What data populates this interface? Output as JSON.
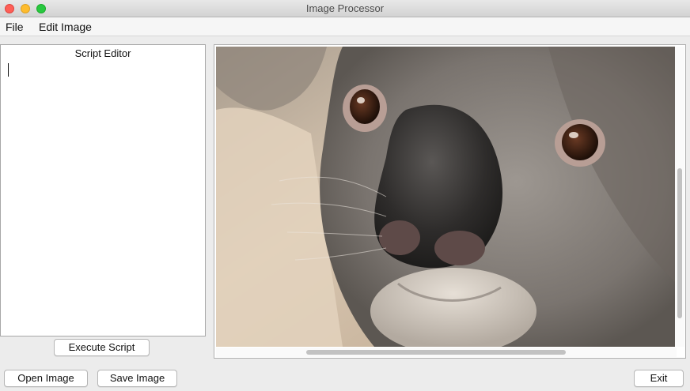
{
  "window": {
    "title": "Image Processor"
  },
  "menu": {
    "file": "File",
    "edit_image": "Edit Image"
  },
  "script_editor": {
    "title": "Script Editor",
    "content": ""
  },
  "buttons": {
    "execute_script": "Execute Script",
    "open_image": "Open Image",
    "save_image": "Save Image",
    "exit": "Exit"
  },
  "image_view": {
    "subject": "koala close-up photo"
  }
}
